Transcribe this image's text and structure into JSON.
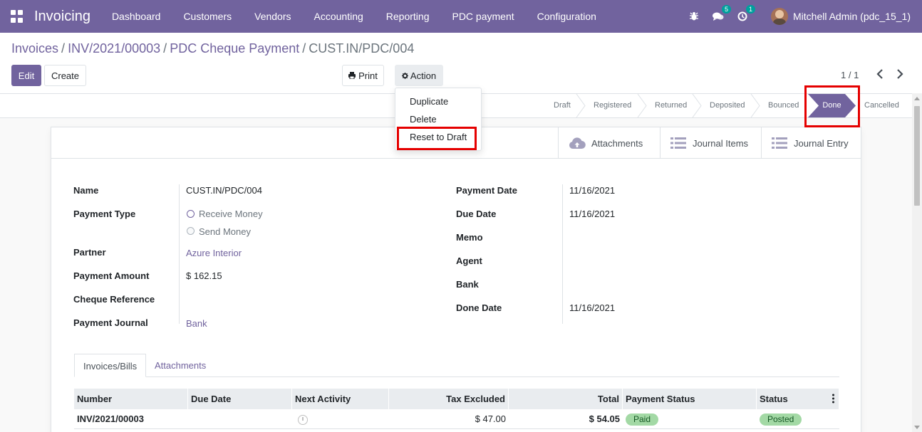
{
  "app": {
    "title": "Invoicing"
  },
  "menu": [
    "Dashboard",
    "Customers",
    "Vendors",
    "Accounting",
    "Reporting",
    "PDC payment",
    "Configuration"
  ],
  "systray": {
    "messages_count": "5",
    "activities_count": "1",
    "user": "Mitchell Admin (pdc_15_1)"
  },
  "breadcrumb": [
    "Invoices",
    "INV/2021/00003",
    "PDC Cheque Payment",
    "CUST.IN/PDC/004"
  ],
  "buttons": {
    "edit": "Edit",
    "create": "Create",
    "print": "Print",
    "action": "Action"
  },
  "pager": {
    "value": "1 / 1"
  },
  "action_menu": [
    "Duplicate",
    "Delete",
    "Reset to Draft"
  ],
  "stages": [
    "Draft",
    "Registered",
    "Returned",
    "Deposited",
    "Bounced",
    "Done",
    "Cancelled"
  ],
  "current_stage": "Done",
  "smart_buttons": [
    "Attachments",
    "Journal Items",
    "Journal Entry"
  ],
  "form_left": {
    "name_label": "Name",
    "name": "CUST.IN/PDC/004",
    "payment_type_label": "Payment Type",
    "payment_type_options": [
      "Receive Money",
      "Send Money"
    ],
    "partner_label": "Partner",
    "partner": "Azure Interior",
    "amount_label": "Payment Amount",
    "amount": "$ 162.15",
    "cheque_ref_label": "Cheque Reference",
    "journal_label": "Payment Journal",
    "journal": "Bank"
  },
  "form_right": {
    "payment_date_label": "Payment Date",
    "payment_date": "11/16/2021",
    "due_date_label": "Due Date",
    "due_date": "11/16/2021",
    "memo_label": "Memo",
    "agent_label": "Agent",
    "bank_label": "Bank",
    "done_date_label": "Done Date",
    "done_date": "11/16/2021"
  },
  "tabs": [
    "Invoices/Bills",
    "Attachments"
  ],
  "table": {
    "columns": [
      "Number",
      "Due Date",
      "Next Activity",
      "Tax Excluded",
      "Total",
      "Payment Status",
      "Status"
    ],
    "rows": [
      {
        "number": "INV/2021/00003",
        "due_date": "",
        "tax_excluded": "$ 47.00",
        "total": "$ 54.05",
        "payment_status": "Paid",
        "status": "Posted"
      }
    ]
  },
  "colors": {
    "brand": "#71639e",
    "highlight": "#e50000",
    "pill_green": "#a3d9a5"
  }
}
